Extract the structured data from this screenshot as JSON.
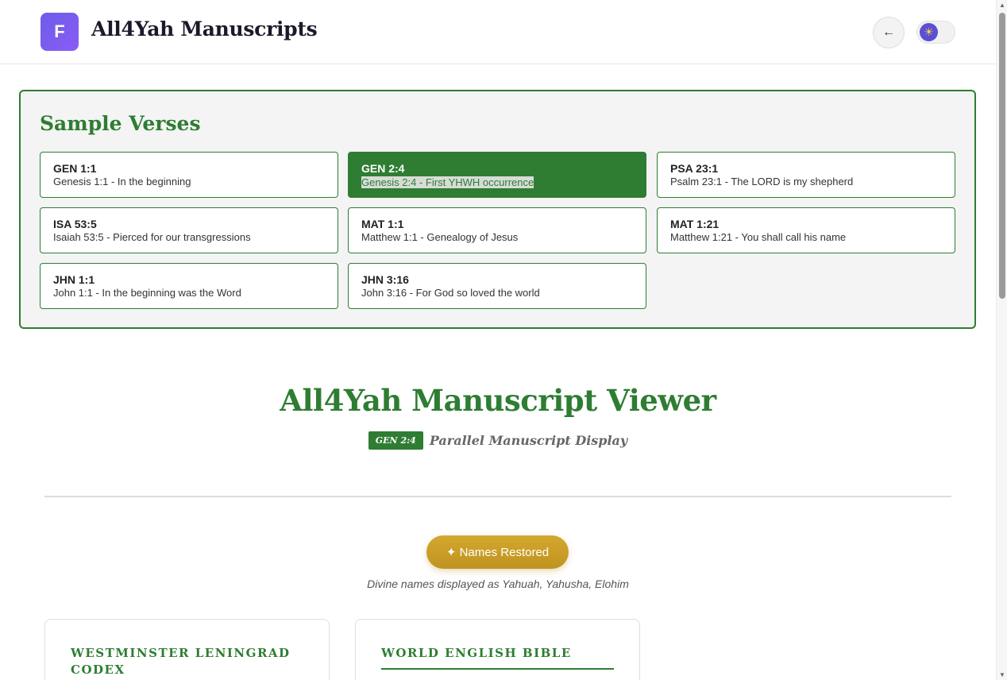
{
  "header": {
    "logo_letter": "F",
    "title": "All4Yah Manuscripts",
    "back_label": "←",
    "theme_icon": "☀"
  },
  "samples": {
    "title": "Sample Verses",
    "items": [
      {
        "ref": "GEN 1:1",
        "desc": "Genesis 1:1 - In the beginning",
        "active": false
      },
      {
        "ref": "GEN 2:4",
        "desc": "Genesis 2:4 - First YHWH occurrence",
        "active": true
      },
      {
        "ref": "PSA 23:1",
        "desc": "Psalm 23:1 - The LORD is my shepherd",
        "active": false
      },
      {
        "ref": "ISA 53:5",
        "desc": "Isaiah 53:5 - Pierced for our transgressions",
        "active": false
      },
      {
        "ref": "MAT 1:1",
        "desc": "Matthew 1:1 - Genealogy of Jesus",
        "active": false
      },
      {
        "ref": "MAT 1:21",
        "desc": "Matthew 1:21 - You shall call his name",
        "active": false
      },
      {
        "ref": "JHN 1:1",
        "desc": "John 1:1 - In the beginning was the Word",
        "active": false
      },
      {
        "ref": "JHN 3:16",
        "desc": "John 3:16 - For God so loved the world",
        "active": false
      }
    ]
  },
  "viewer": {
    "title": "All4Yah Manuscript Viewer",
    "ref_badge": "GEN 2:4",
    "subtitle": "Parallel Manuscript Display",
    "names_button": "✦ Names Restored",
    "names_note": "Divine names displayed as Yahuah, Yahusha, Elohim"
  },
  "manuscripts": [
    {
      "title": "WESTMINSTER LENINGRAD CODEX"
    },
    {
      "title": "WORLD ENGLISH BIBLE"
    }
  ],
  "colors": {
    "accent": "#2e7d32",
    "gold": "#c99b26",
    "logo": "#7a5cf0"
  }
}
